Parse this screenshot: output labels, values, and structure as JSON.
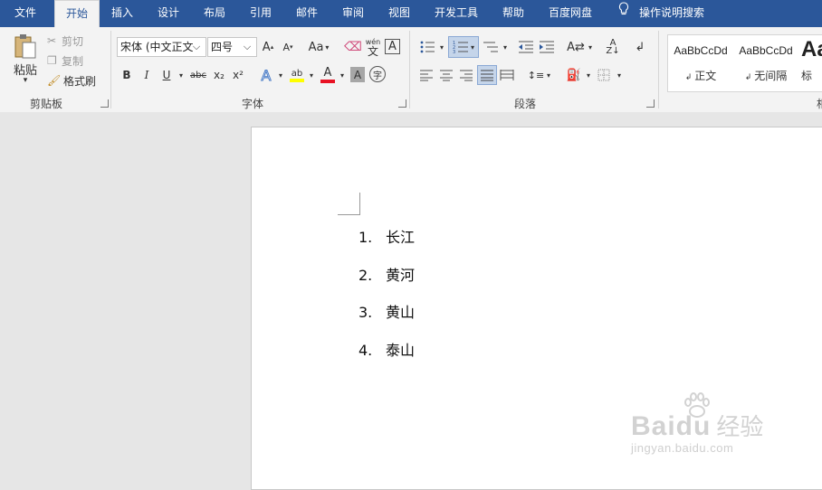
{
  "tabs": {
    "file": "文件",
    "home": "开始",
    "insert": "插入",
    "design": "设计",
    "layout": "布局",
    "references": "引用",
    "mailings": "邮件",
    "review": "审阅",
    "view": "视图",
    "developer": "开发工具",
    "help": "帮助",
    "baidu_pan": "百度网盘",
    "tell_me": "操作说明搜索"
  },
  "clipboard": {
    "paste": "粘贴",
    "cut": "剪切",
    "copy": "复制",
    "format_painter": "格式刷",
    "group_label": "剪贴板"
  },
  "font": {
    "font_name": "宋体 (中文正文",
    "font_size": "四号",
    "grow": "A",
    "shrink": "A",
    "change_case": "Aa",
    "phonetic": "wén",
    "phonetic_char": "文",
    "char_border": "A",
    "bold": "B",
    "italic": "I",
    "underline": "U",
    "strikethrough": "abc",
    "subscript": "x₂",
    "superscript": "x²",
    "text_effects": "A",
    "highlight": "ab",
    "font_color": "A",
    "char_shading": "A",
    "enclose_char": "字",
    "group_label": "字体"
  },
  "paragraph": {
    "group_label": "段落"
  },
  "styles": {
    "items": [
      {
        "sample": "AaBbCcDd",
        "name": "正文"
      },
      {
        "sample": "AaBbCcDd",
        "name": "无间隔"
      },
      {
        "sample": "Aa",
        "name": "标"
      }
    ],
    "group_label_partial": "相"
  },
  "document": {
    "list": [
      {
        "num": "1.",
        "text": "长江"
      },
      {
        "num": "2.",
        "text": "黄河"
      },
      {
        "num": "3.",
        "text": "黄山"
      },
      {
        "num": "4.",
        "text": "泰山"
      }
    ]
  },
  "watermark": {
    "logo": "Baidu",
    "cn": "经验",
    "url": "jingyan.baidu.com"
  },
  "colors": {
    "tab_bar": "#2b579a",
    "ribbon": "#f3f3f3",
    "highlight_yellow": "#ffff00",
    "font_red": "#e81123",
    "selected_button": "#c5d5ea"
  }
}
